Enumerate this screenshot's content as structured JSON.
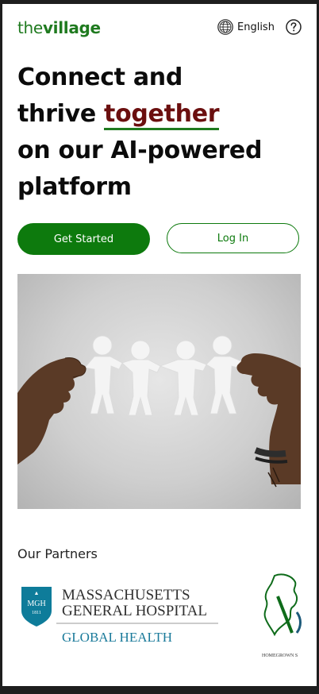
{
  "header": {
    "logo_the": "the",
    "logo_village": "village",
    "language": "English"
  },
  "hero": {
    "line1": "Connect and",
    "line2_prefix": "thrive ",
    "line2_highlight": "together",
    "line3": "on our AI-powered",
    "line4": "platform"
  },
  "actions": {
    "get_started": "Get Started",
    "log_in": "Log In"
  },
  "partners": {
    "title": "Our Partners",
    "items": [
      {
        "badge_top": "MGH",
        "badge_year": "1811",
        "line1": "MASSACHUSETTS",
        "line2": "GENERAL HOSPITAL",
        "line3": "GLOBAL HEALTH"
      },
      {
        "caption": "HOMEGROWN S"
      }
    ]
  },
  "colors": {
    "brand_green": "#0d7a0d",
    "highlight_red": "#6b0f0f",
    "mgh_teal": "#0e7c9a"
  },
  "icons": [
    "globe-icon",
    "help-icon"
  ]
}
